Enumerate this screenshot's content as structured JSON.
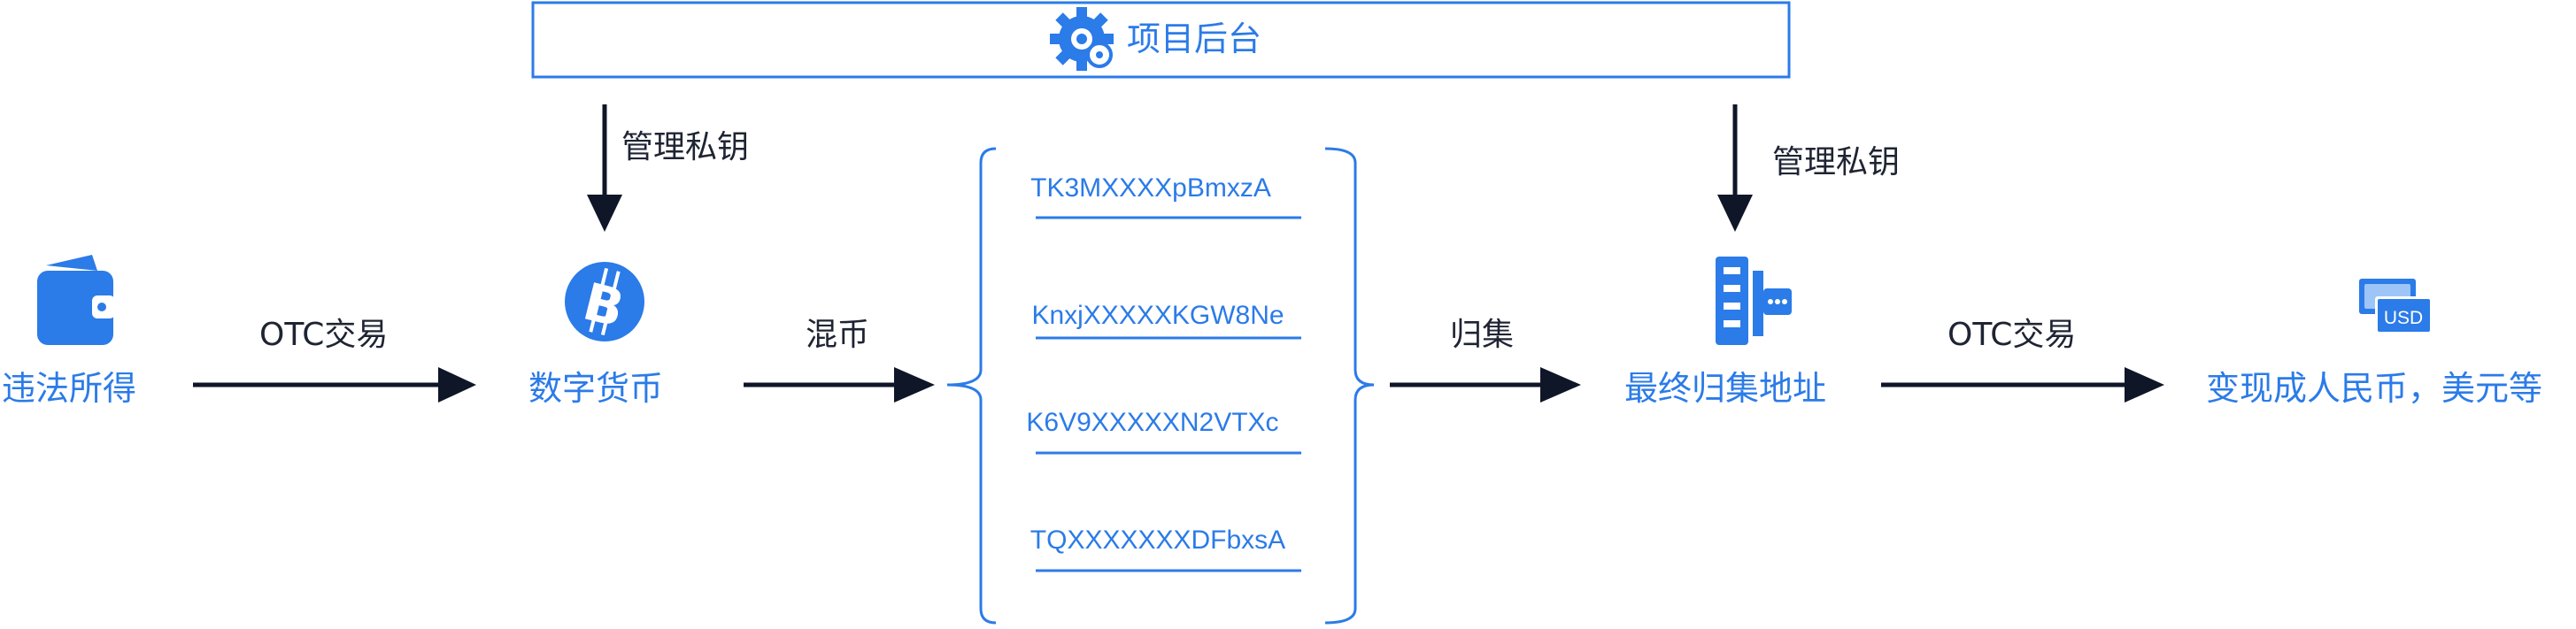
{
  "header": {
    "title": "项目后台"
  },
  "steps": {
    "illegal_income": "违法所得",
    "crypto": "数字货币",
    "final_address": "最终归集地址",
    "cash_out": "变现成人民币，美元等"
  },
  "edges": {
    "otc_trade_1": "OTC交易",
    "mixing": "混币",
    "collect": "归集",
    "otc_trade_2": "OTC交易",
    "manage_key_left": "管理私钥",
    "manage_key_right": "管理私钥"
  },
  "addresses": [
    "TK3MXXXXpBmxzA",
    "KnxjXXXXXKGW8Ne",
    "K6V9XXXXXN2VTXc",
    "TQXXXXXXXDFbxsA"
  ],
  "currency_badge": "USD",
  "icons": {
    "backend": "gear-icon",
    "wallet": "wallet-icon",
    "bitcoin": "bitcoin-icon",
    "server": "server-icon",
    "cash": "cash-icon"
  },
  "colors": {
    "accent": "#2B7BE8",
    "arrow": "#0F1628",
    "label": "#1F2433"
  }
}
